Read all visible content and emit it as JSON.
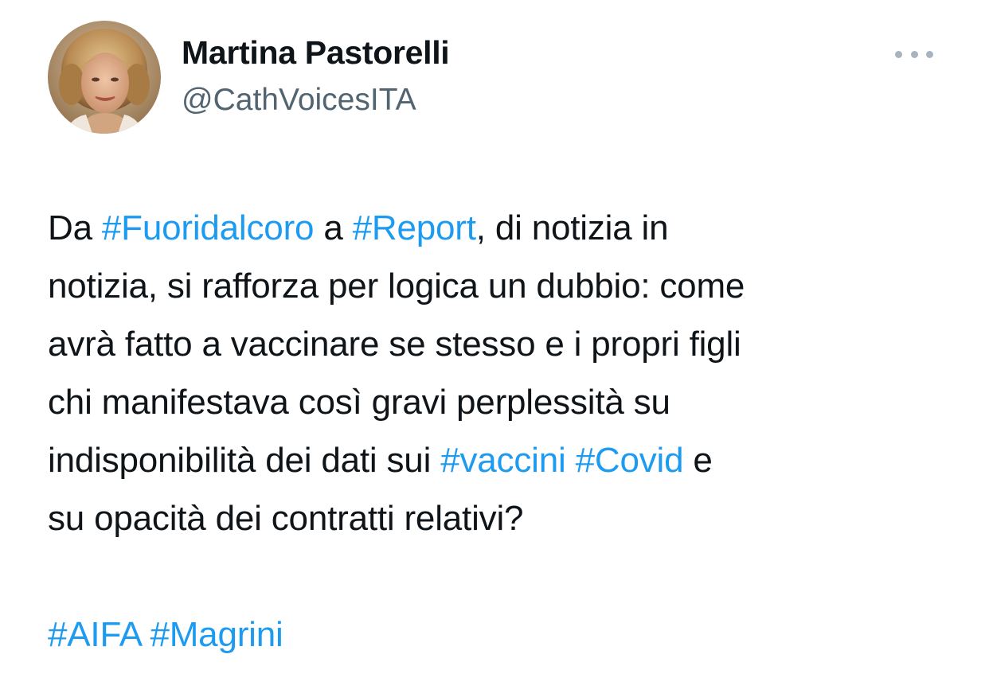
{
  "author": {
    "display_name": "Martina Pastorelli",
    "handle": "@CathVoicesITA"
  },
  "colors": {
    "text": "#0f1419",
    "secondary": "#536471",
    "link": "#1d9bf0",
    "background": "#ffffff"
  },
  "icons": {
    "more": "more-horizontal-icon"
  },
  "tweet": {
    "line1": {
      "t1": "Da ",
      "h1": "#Fuoridalcoro",
      "t2": " a ",
      "h2": "#Report",
      "t3": ", di notizia in"
    },
    "line2": "notizia, si rafforza per logica un dubbio: come",
    "line3": "avrà fatto a vaccinare se stesso e i propri figli",
    "line4": "chi manifestava così gravi perplessità su",
    "line5": {
      "t1": "indisponibilità dei dati sui ",
      "h1": "#vaccini",
      "t2": " ",
      "h2": "#Covid",
      "t3": " e"
    },
    "line6": "su opacità dei contratti relativi?",
    "tags": {
      "h1": "#AIFA",
      "sep": " ",
      "h2": "#Magrini"
    }
  }
}
